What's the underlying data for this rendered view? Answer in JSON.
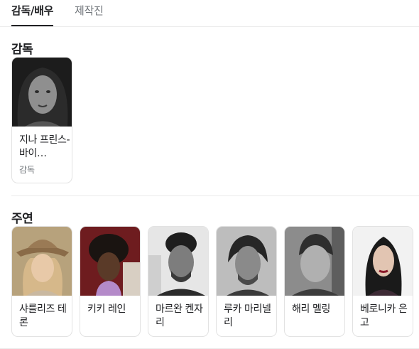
{
  "tabs": {
    "active": "감독/배우",
    "inactive": "제작진"
  },
  "director_section": {
    "title": "감독",
    "people": [
      {
        "name": "지나 프린스-바이…",
        "role": "감독"
      }
    ]
  },
  "cast_section": {
    "title": "주연",
    "people": [
      {
        "name": "샤를리즈 테론"
      },
      {
        "name": "키키 레인"
      },
      {
        "name": "마르완 켄자리"
      },
      {
        "name": "루카 마리넬리"
      },
      {
        "name": "해리 멜링"
      },
      {
        "name": "베로니카 은고"
      }
    ]
  }
}
